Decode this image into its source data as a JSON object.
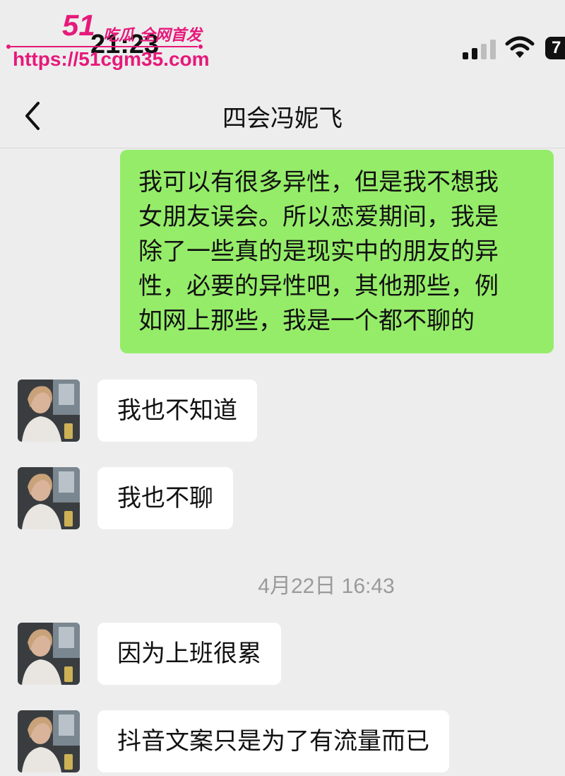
{
  "status_bar": {
    "time": "21:23",
    "battery": "7"
  },
  "watermark": {
    "brand_number": "51",
    "brand_tag": "吃瓜 全网首发",
    "url": "https://51cgm35.com"
  },
  "nav": {
    "title": "四会冯妮飞"
  },
  "messages": [
    {
      "direction": "outgoing",
      "lines": [
        "我可以有很多异性，但是我不想我",
        "女朋友误会。所以恋爱期间，我是",
        "除了一些真的是现实中的朋友的异",
        "性，必要的异性吧，其他那些，例",
        "如网上那些，我是一个都不聊的"
      ]
    },
    {
      "direction": "incoming",
      "text": "我也不知道"
    },
    {
      "direction": "incoming",
      "text": "我也不聊"
    },
    {
      "direction": "incoming",
      "text": "因为上班很累"
    },
    {
      "direction": "incoming",
      "text": "抖音文案只是为了有流量而已"
    }
  ],
  "timestamp": "4月22日 16:43",
  "colors": {
    "background": "#ededed",
    "outgoing_bubble": "#95ec69",
    "incoming_bubble": "#ffffff",
    "watermark": "#e6197a",
    "timestamp": "#9a9a9a"
  },
  "icons": {
    "back": "chevron-left-icon",
    "signal": "signal-bars-icon",
    "wifi": "wifi-icon",
    "battery": "battery-icon"
  }
}
